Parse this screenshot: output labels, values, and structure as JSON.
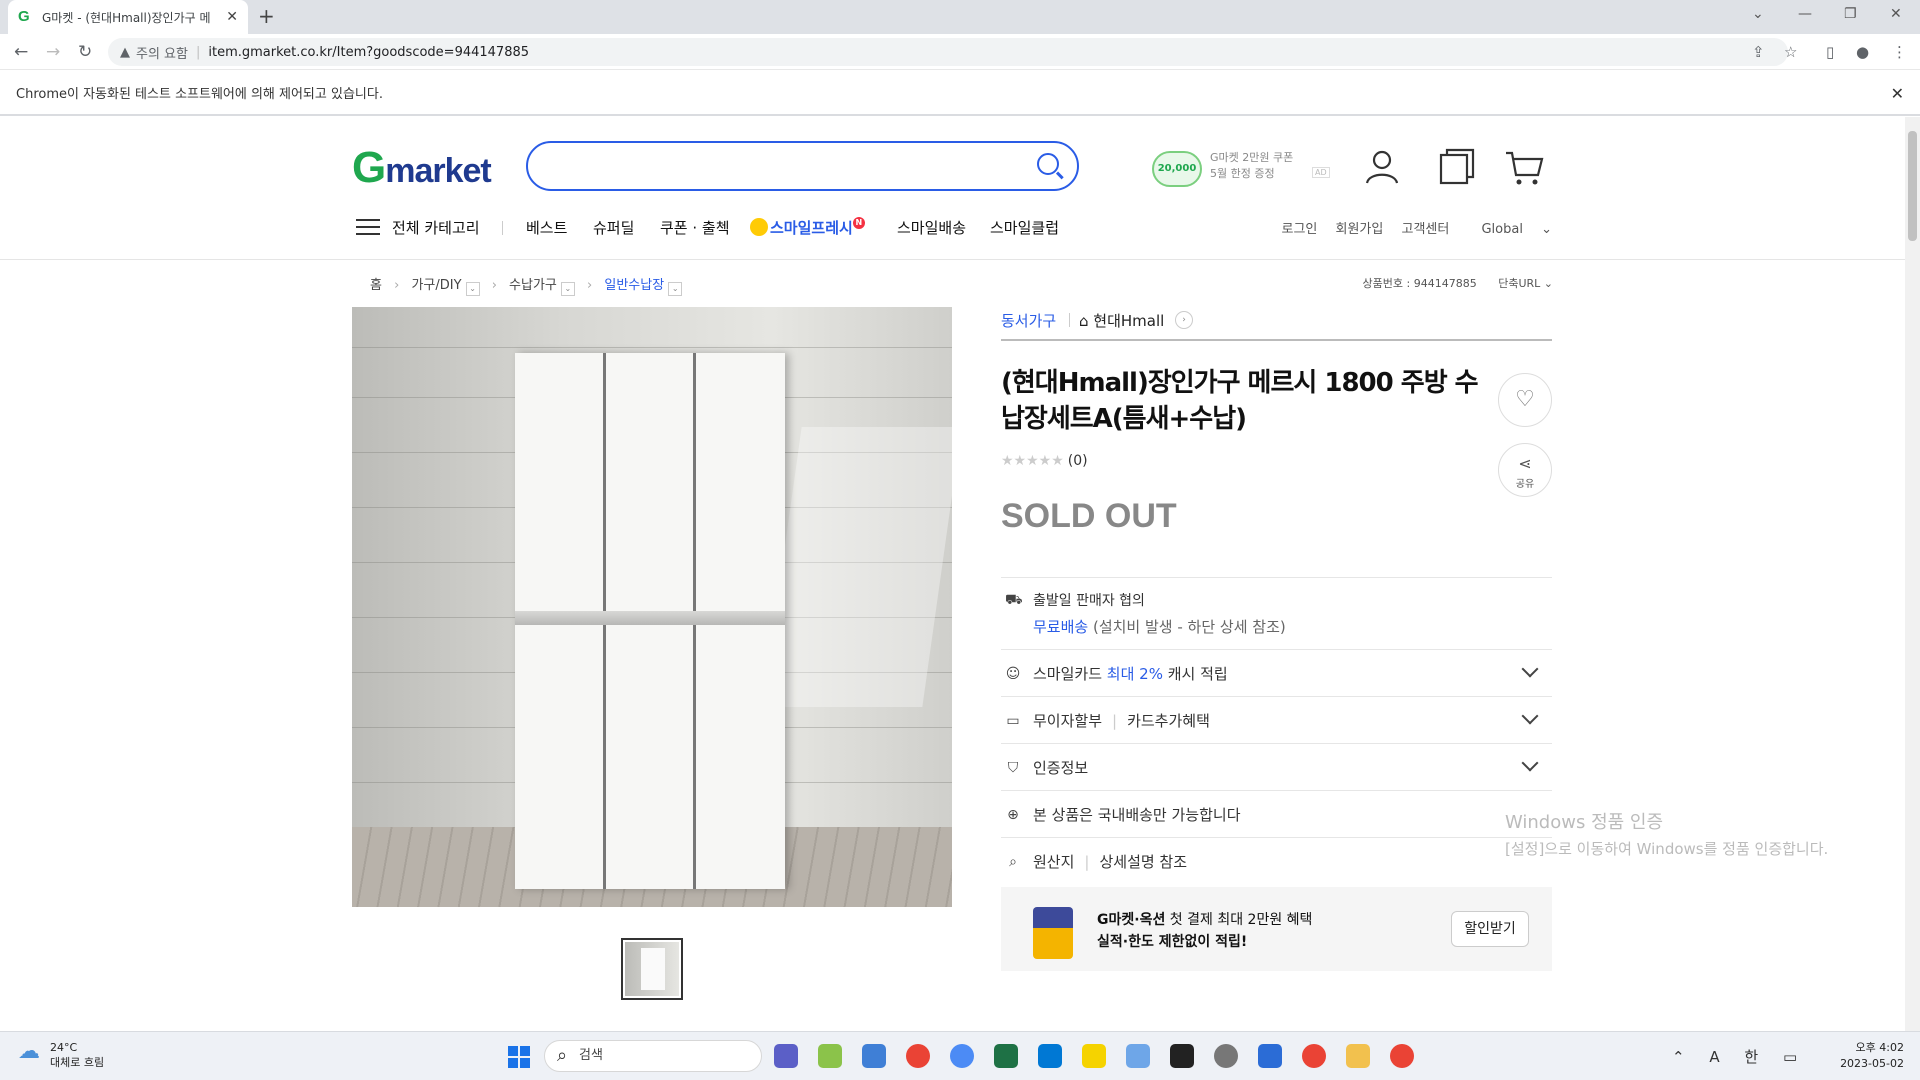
{
  "browser": {
    "tab_title": "G마켓 - (현대Hmall)장인가구 메",
    "favicon_letter": "G",
    "url_warning": "주의 요함",
    "url": "item.gmarket.co.kr/Item?goodscode=944147885",
    "infobar_text": "Chrome이 자동화된 테스트 소프트웨어에 의해 제어되고 있습니다."
  },
  "header": {
    "logo_g": "G",
    "logo_rest": "market",
    "promo_coin": "20,000",
    "promo_line1": "G마켓 2만원 쿠폰",
    "promo_line2": "5월 한정 증정",
    "promo_ad": "AD"
  },
  "nav": {
    "all_categories": "전체 카테고리",
    "items": [
      "베스트",
      "슈퍼딜",
      "쿠폰 · 출첵",
      "스마일프레시",
      "스마일배송",
      "스마일클럽"
    ],
    "fresh_badge": "N",
    "util": [
      "로그인",
      "회원가입",
      "고객센터",
      "Global"
    ]
  },
  "breadcrumb": {
    "home": "홈",
    "levels": [
      "가구/DIY",
      "수납가구",
      "일반수납장"
    ],
    "product_no": "상품번호 : 944147885",
    "short_url": "단축URL"
  },
  "product": {
    "brand": "동서가구",
    "seller": "현대Hmall",
    "title": "(현대Hmall)장인가구 메르시 1800 주방 수납장세트A(틈새+수납)",
    "stars": "★★★★★",
    "review_count": "(0)",
    "status": "SOLD OUT",
    "share_label": "공유",
    "shipping_line1": "출발일 판매자 협의",
    "shipping_free": "무료배송",
    "shipping_note": "(설치비 발생 - 하단 상세 참조)",
    "smilecard_prefix": "스마일카드",
    "smilecard_highlight": "최대 2%",
    "smilecard_suffix": "캐시 적립",
    "installment": "무이자할부",
    "card_benefit": "카드추가혜택",
    "certification": "인증정보",
    "domestic": "본 상품은 국내배송만 가능합니다",
    "origin_label": "원산지",
    "origin_value": "상세설명 참조"
  },
  "banner": {
    "line1_bold": "G마켓·옥션",
    "line1_rest": " 첫 결제 최대 2만원 혜택",
    "line2": "실적·한도 제한없이 적립!",
    "button": "할인받기"
  },
  "watermark": {
    "line1": "Windows 정품 인증",
    "line2": "[설정]으로 이동하여 Windows를 정품 인증합니다."
  },
  "taskbar": {
    "temp": "24°C",
    "weather": "대체로 흐림",
    "search": "검색",
    "ime_a": "A",
    "ime_han": "한",
    "time": "오후 4:02",
    "date": "2023-05-02"
  },
  "colors": {
    "accent": "#2a5ce6",
    "logo_green": "#1fa74e",
    "sold_out": "#888888"
  }
}
